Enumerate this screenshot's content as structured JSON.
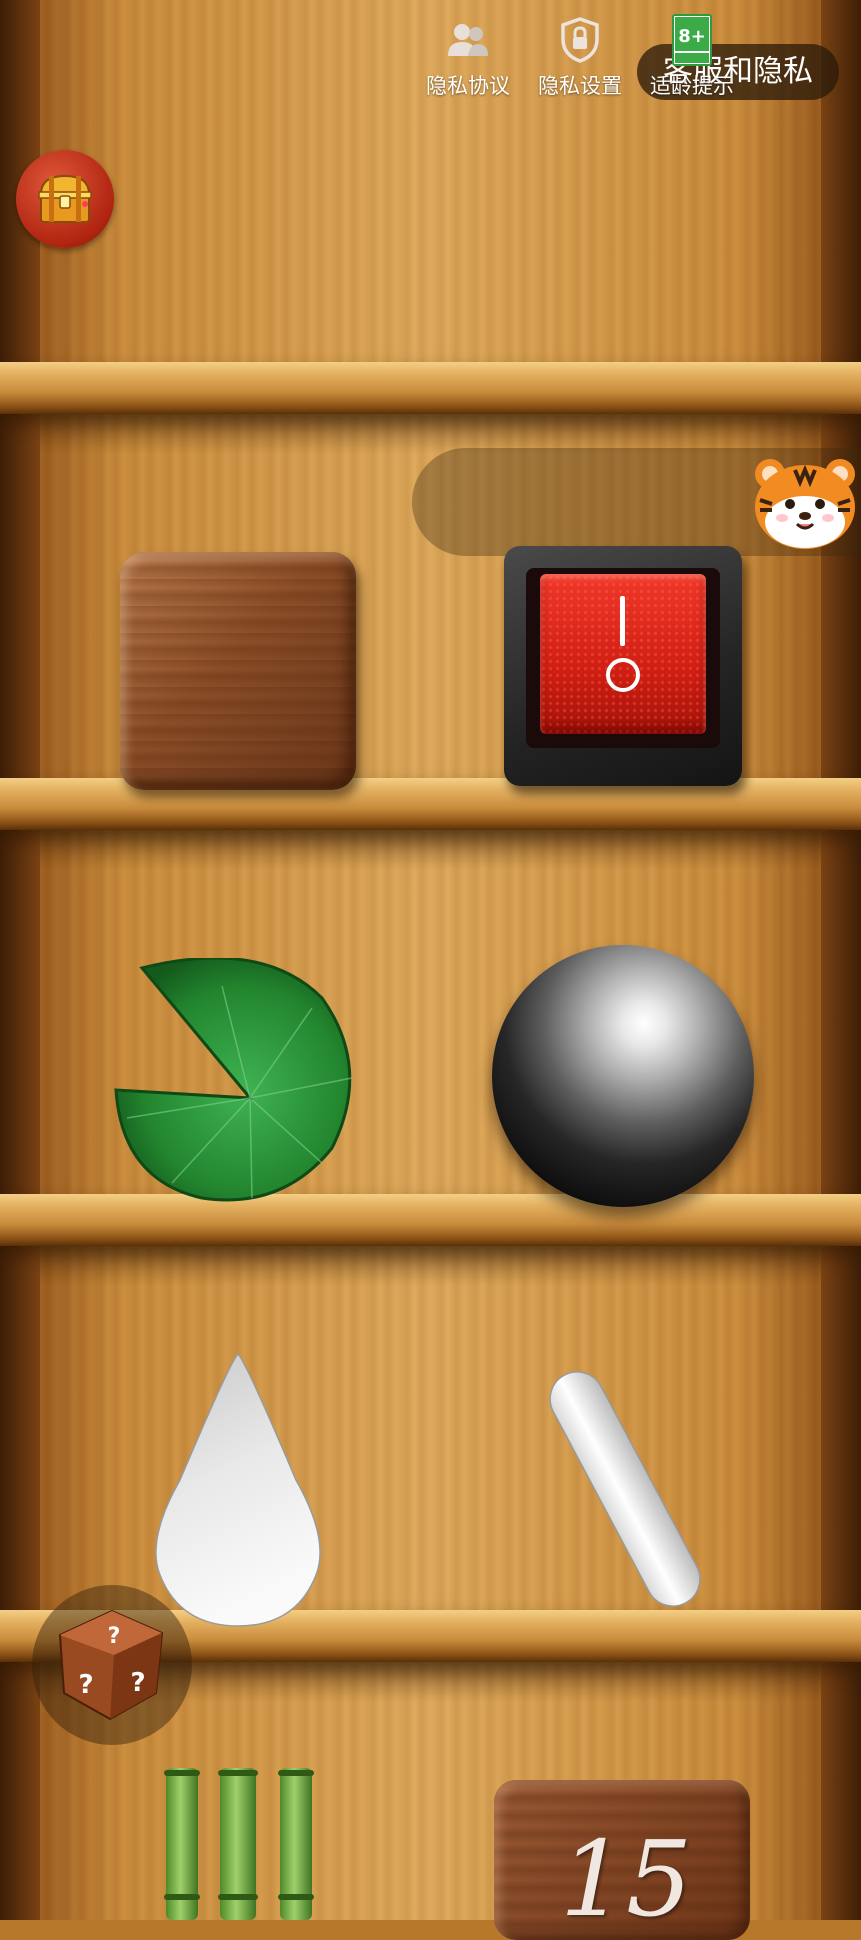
{
  "header": {
    "service_privacy_label": "客服和隐私"
  },
  "privacy_toolbar": {
    "items": [
      {
        "label": "隐私协议",
        "icon": "users-icon"
      },
      {
        "label": "隐私设置",
        "icon": "shield-lock-icon"
      },
      {
        "label": "适龄提示",
        "icon": "age-rating-icon"
      }
    ],
    "age_badge": "8+",
    "mascot": "tiger-mascot-icon"
  },
  "shelf_items": [
    {
      "name": "wooden-block",
      "icon": "wooden-block-icon"
    },
    {
      "name": "power-switch",
      "icon": "rocker-switch-icon"
    },
    {
      "name": "lotus-leaf",
      "icon": "lotus-leaf-icon"
    },
    {
      "name": "steel-ball",
      "icon": "steel-ball-icon"
    },
    {
      "name": "water-drop",
      "icon": "water-drop-icon"
    },
    {
      "name": "chalk",
      "icon": "chalk-icon"
    },
    {
      "name": "bamboo",
      "icon": "bamboo-icon"
    },
    {
      "name": "number-tile",
      "icon": "number-tile-icon"
    }
  ],
  "number_tile_value": "15",
  "floating_buttons": {
    "treasure": "treasure-chest-icon",
    "random": "dice-icon"
  },
  "colors": {
    "wood_light": "#dda85a",
    "wood_dark": "#6b3a10",
    "switch_red": "#d01e12",
    "leaf_green": "#2d9a3e"
  }
}
